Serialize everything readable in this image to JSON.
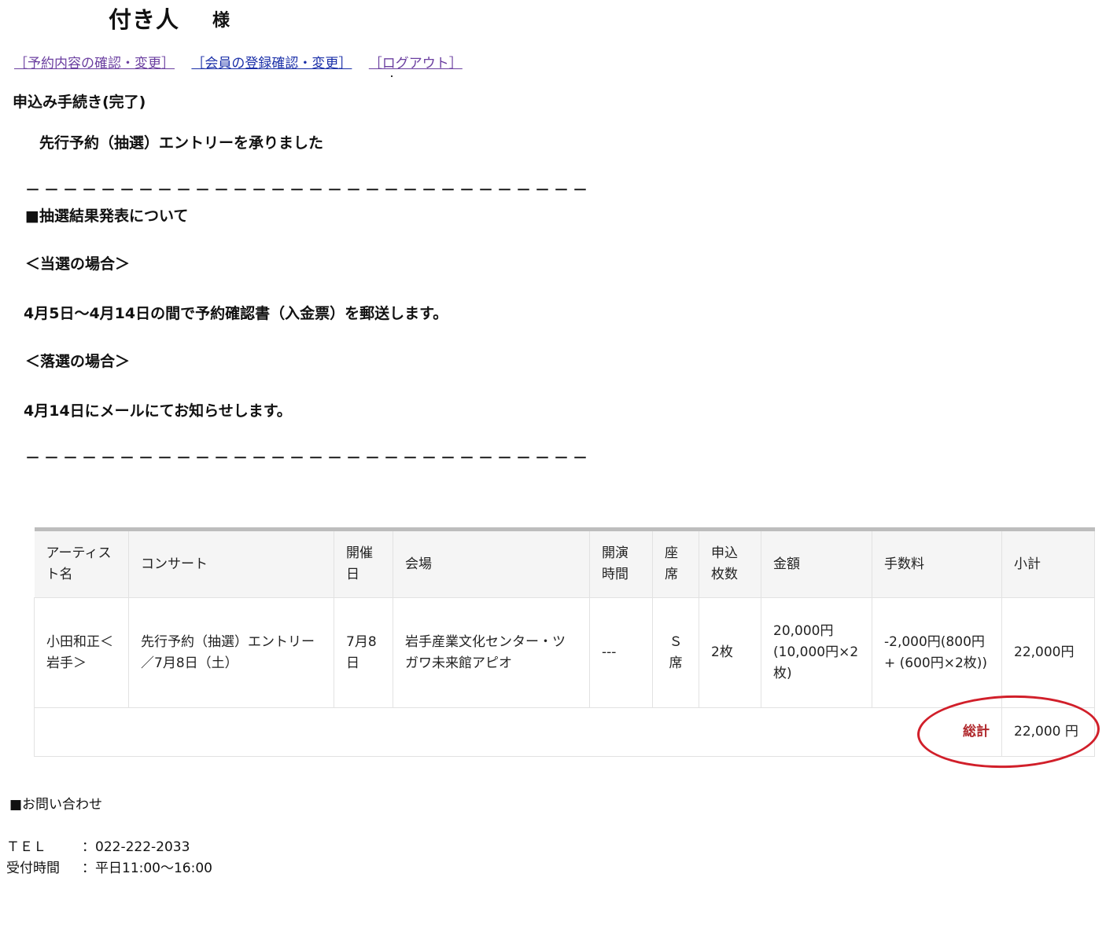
{
  "header": {
    "user_name": "付き人",
    "honorific": "様"
  },
  "nav": {
    "reservation_link": "［予約内容の確認・変更］",
    "member_link": "［会員の登録確認・変更］",
    "logout_link": "［ログアウト］"
  },
  "content": {
    "procedure_title": "申込み手続き(完了)",
    "completion_message": "先行予約（抽選）エントリーを承りました",
    "rule_line": "－－－－－－－－－－－－－－－－－－－－－－－－－－－－－－",
    "lottery_heading": "■抽選結果発表について",
    "win_heading": "＜当選の場合＞",
    "win_text": "4月5日～4月14日の間で予約確認書（入金票）を郵送します。",
    "lose_heading": "＜落選の場合＞",
    "lose_text": "4月14日にメールにてお知らせします。"
  },
  "table": {
    "headers": {
      "artist": "アーティスト名",
      "concert": "コンサート",
      "date": "開催日",
      "venue": "会場",
      "start_time": "開演時間",
      "seat": "座席",
      "quantity": "申込枚数",
      "amount": "金額",
      "fee": "手数料",
      "subtotal": "小計"
    },
    "row": {
      "artist": "小田和正＜岩手＞",
      "concert": "先行予約（抽選）エントリー／7月8日（土）",
      "date": "7月8日",
      "venue": "岩手産業文化センター・ツガワ未来館アピオ",
      "start_time": "---",
      "seat": "Ｓ席",
      "quantity": "2枚",
      "amount": "20,000円(10,000円×2枚)",
      "fee": "-2,000円(800円+ (600円×2枚))",
      "subtotal": "22,000円"
    },
    "total_label": "総計",
    "total_value": "22,000 円"
  },
  "contact": {
    "heading": "■お問い合わせ",
    "tel_label": "ＴＥＬ",
    "tel_value": "：022-222-2033",
    "hours_label": "受付時間",
    "hours_value": "：平日11:00～16:00"
  },
  "colors": {
    "total_label": "#b0282c",
    "annotation_ellipse": "#d11f2a",
    "link": "#1a2fa8",
    "visited_link": "#6b3fa0"
  }
}
